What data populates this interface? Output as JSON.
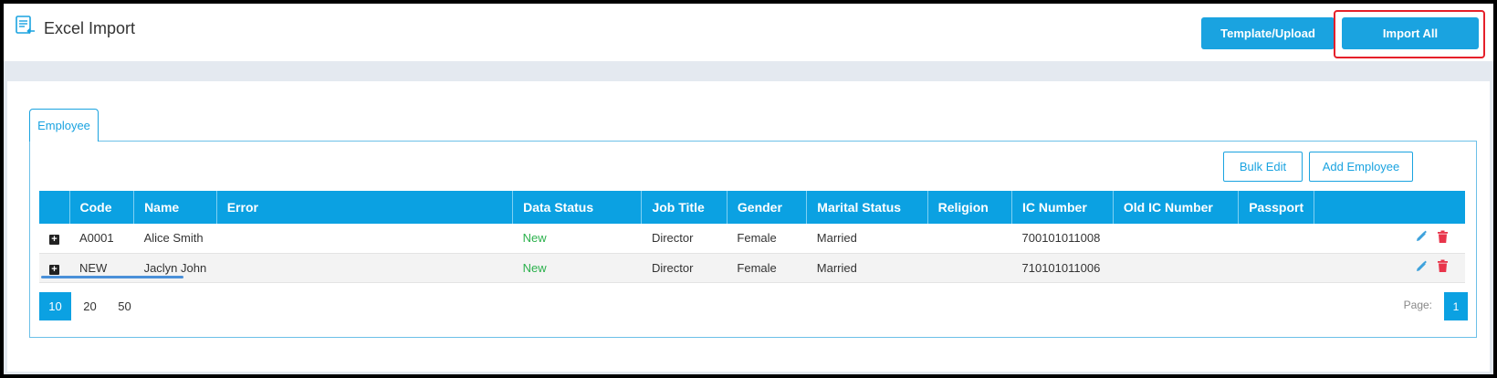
{
  "header": {
    "title": "Excel Import",
    "template_upload_label": "Template/Upload",
    "import_all_label": "Import All"
  },
  "tabs": [
    {
      "label": "Employee"
    }
  ],
  "toolbar": {
    "bulk_edit_label": "Bulk Edit",
    "add_employee_label": "Add Employee"
  },
  "table": {
    "columns": [
      "",
      "Code",
      "Name",
      "Error",
      "Data Status",
      "Job Title",
      "Gender",
      "Marital Status",
      "Religion",
      "IC Number",
      "Old IC Number",
      "Passport",
      ""
    ],
    "rows": [
      {
        "code": "A0001",
        "name": "Alice Smith",
        "error": "",
        "data_status": "New",
        "job_title": "Director",
        "gender": "Female",
        "marital_status": "Married",
        "religion": "",
        "ic_number": "700101011008",
        "old_ic_number": "",
        "passport": ""
      },
      {
        "code": "NEW",
        "name": "Jaclyn John",
        "error": "",
        "data_status": "New",
        "job_title": "Director",
        "gender": "Female",
        "marital_status": "Married",
        "religion": "",
        "ic_number": "710101011006",
        "old_ic_number": "",
        "passport": ""
      }
    ]
  },
  "pagination": {
    "page_sizes": [
      "10",
      "20",
      "50"
    ],
    "active_page_size": "10",
    "page_label": "Page:",
    "current_page": "1"
  },
  "colors": {
    "accent": "#0ba1e2",
    "status_new": "#2bb14c",
    "delete": "#e8344a",
    "highlight": "#e5202a"
  }
}
